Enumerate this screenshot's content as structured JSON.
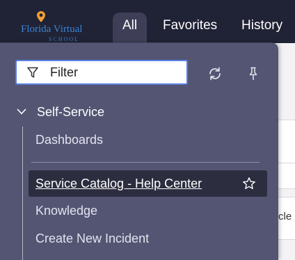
{
  "brand": {
    "logo_line1": "Florida Virtual",
    "logo_line2": "SCHOOL"
  },
  "nav": {
    "tabs": [
      {
        "label": "All",
        "active": true
      },
      {
        "label": "Favorites",
        "active": false
      },
      {
        "label": "History",
        "active": false
      }
    ]
  },
  "menu": {
    "filter": {
      "placeholder": "Filter",
      "value": ""
    },
    "group": {
      "label": "Self-Service",
      "expanded": true,
      "items": [
        {
          "label": "Dashboards"
        },
        {
          "label": "Service Catalog - Help Center",
          "highlighted": true,
          "favorited": false
        },
        {
          "label": "Knowledge"
        },
        {
          "label": "Create New Incident"
        }
      ]
    }
  },
  "background": {
    "partial_text": "cle"
  },
  "colors": {
    "topbar": "#202235",
    "menu_bg": "#464868",
    "active_tab": "#3e3f56",
    "highlight_row": "#2c2d3f",
    "filter_border": "#5a7fe0",
    "logo_blue": "#3a84d4",
    "logo_pin": "#f0a030"
  }
}
